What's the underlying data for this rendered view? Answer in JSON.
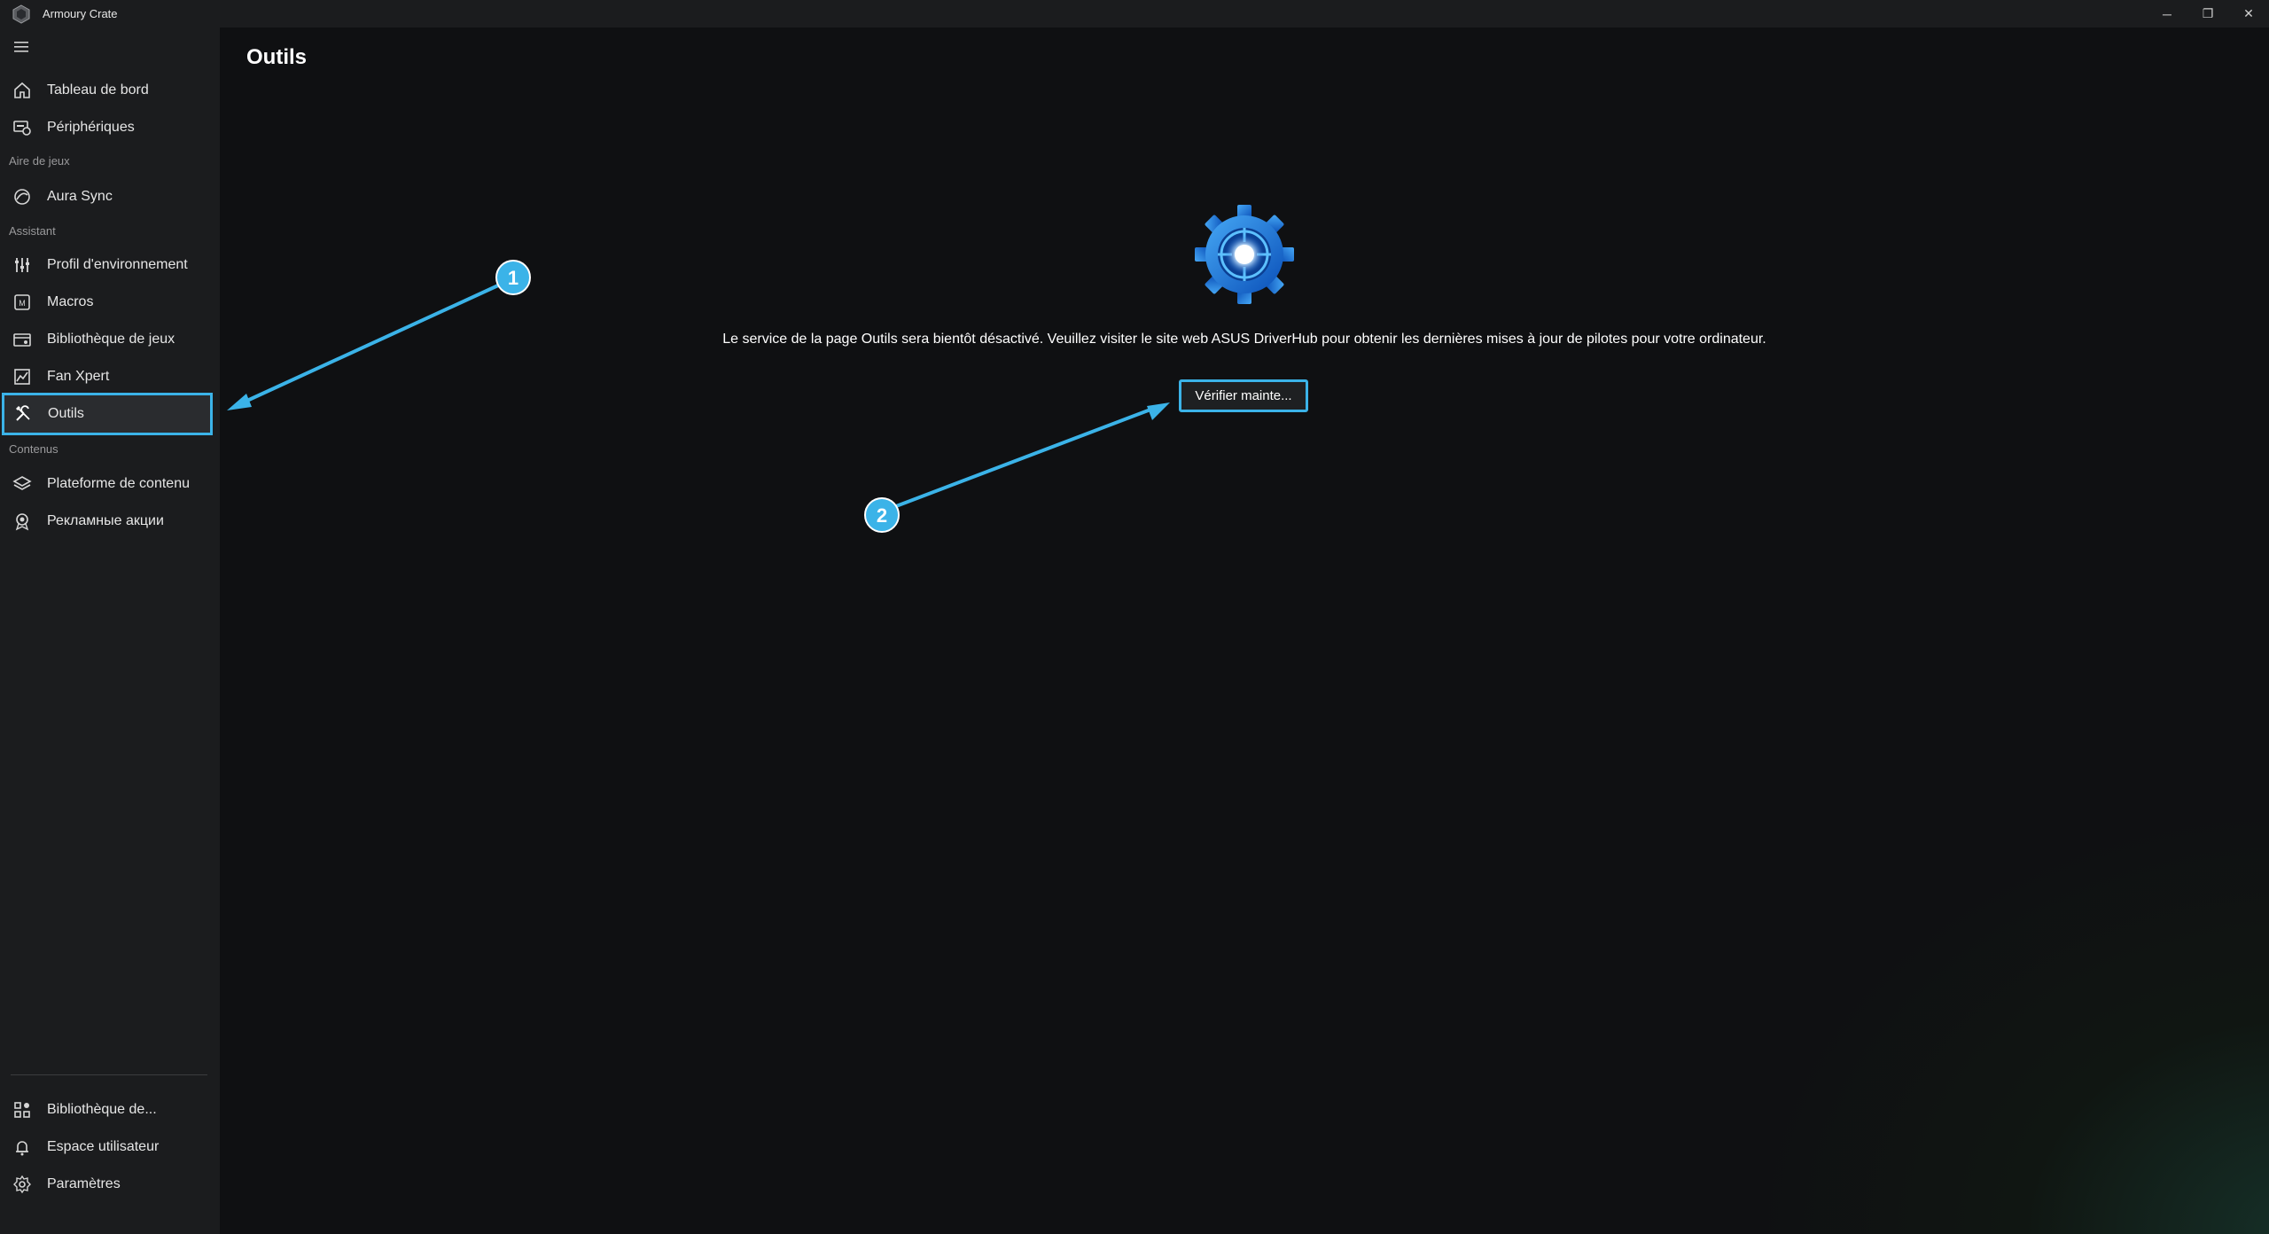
{
  "window": {
    "title": "Armoury Crate",
    "controls": [
      "─",
      "❐",
      "✕"
    ]
  },
  "sidebar": {
    "items": [
      {
        "label": "Tableau de bord",
        "icon": "home-icon"
      },
      {
        "label": "Périphériques",
        "icon": "devices-icon"
      },
      {
        "section": "Aire de jeux"
      },
      {
        "label": "Aura Sync",
        "icon": "aura-icon"
      },
      {
        "section": "Assistant"
      },
      {
        "label": "Profil d'environnement",
        "icon": "sliders-icon"
      },
      {
        "label": "Macros",
        "icon": "macro-icon"
      },
      {
        "label": "Bibliothèque de jeux",
        "icon": "game-library-icon"
      },
      {
        "label": "Fan Xpert",
        "icon": "fan-icon"
      },
      {
        "label": "Outils",
        "icon": "tools-icon",
        "active": true
      },
      {
        "section": "Contenus"
      },
      {
        "label": "Plateforme de contenu",
        "icon": "layers-icon"
      },
      {
        "label": "Рекламные акции",
        "icon": "badge-icon"
      }
    ],
    "bottom_items": [
      {
        "label": "Bibliothèque de...",
        "icon": "apps-icon"
      },
      {
        "label": "Espace utilisateur",
        "icon": "bell-icon"
      },
      {
        "label": "Paramètres",
        "icon": "gear-icon"
      }
    ]
  },
  "main": {
    "title": "Outils",
    "notice": "Le service de la page Outils sera bientôt désactivé. Veuillez visiter le site web ASUS DriverHub pour obtenir les dernières mises à jour de pilotes pour votre ordinateur.",
    "button_label": "Vérifier mainte...",
    "icon": "tool-gear-icon"
  },
  "annotations": {
    "badges": [
      "1",
      "2"
    ],
    "color": "#3bb3e8"
  }
}
